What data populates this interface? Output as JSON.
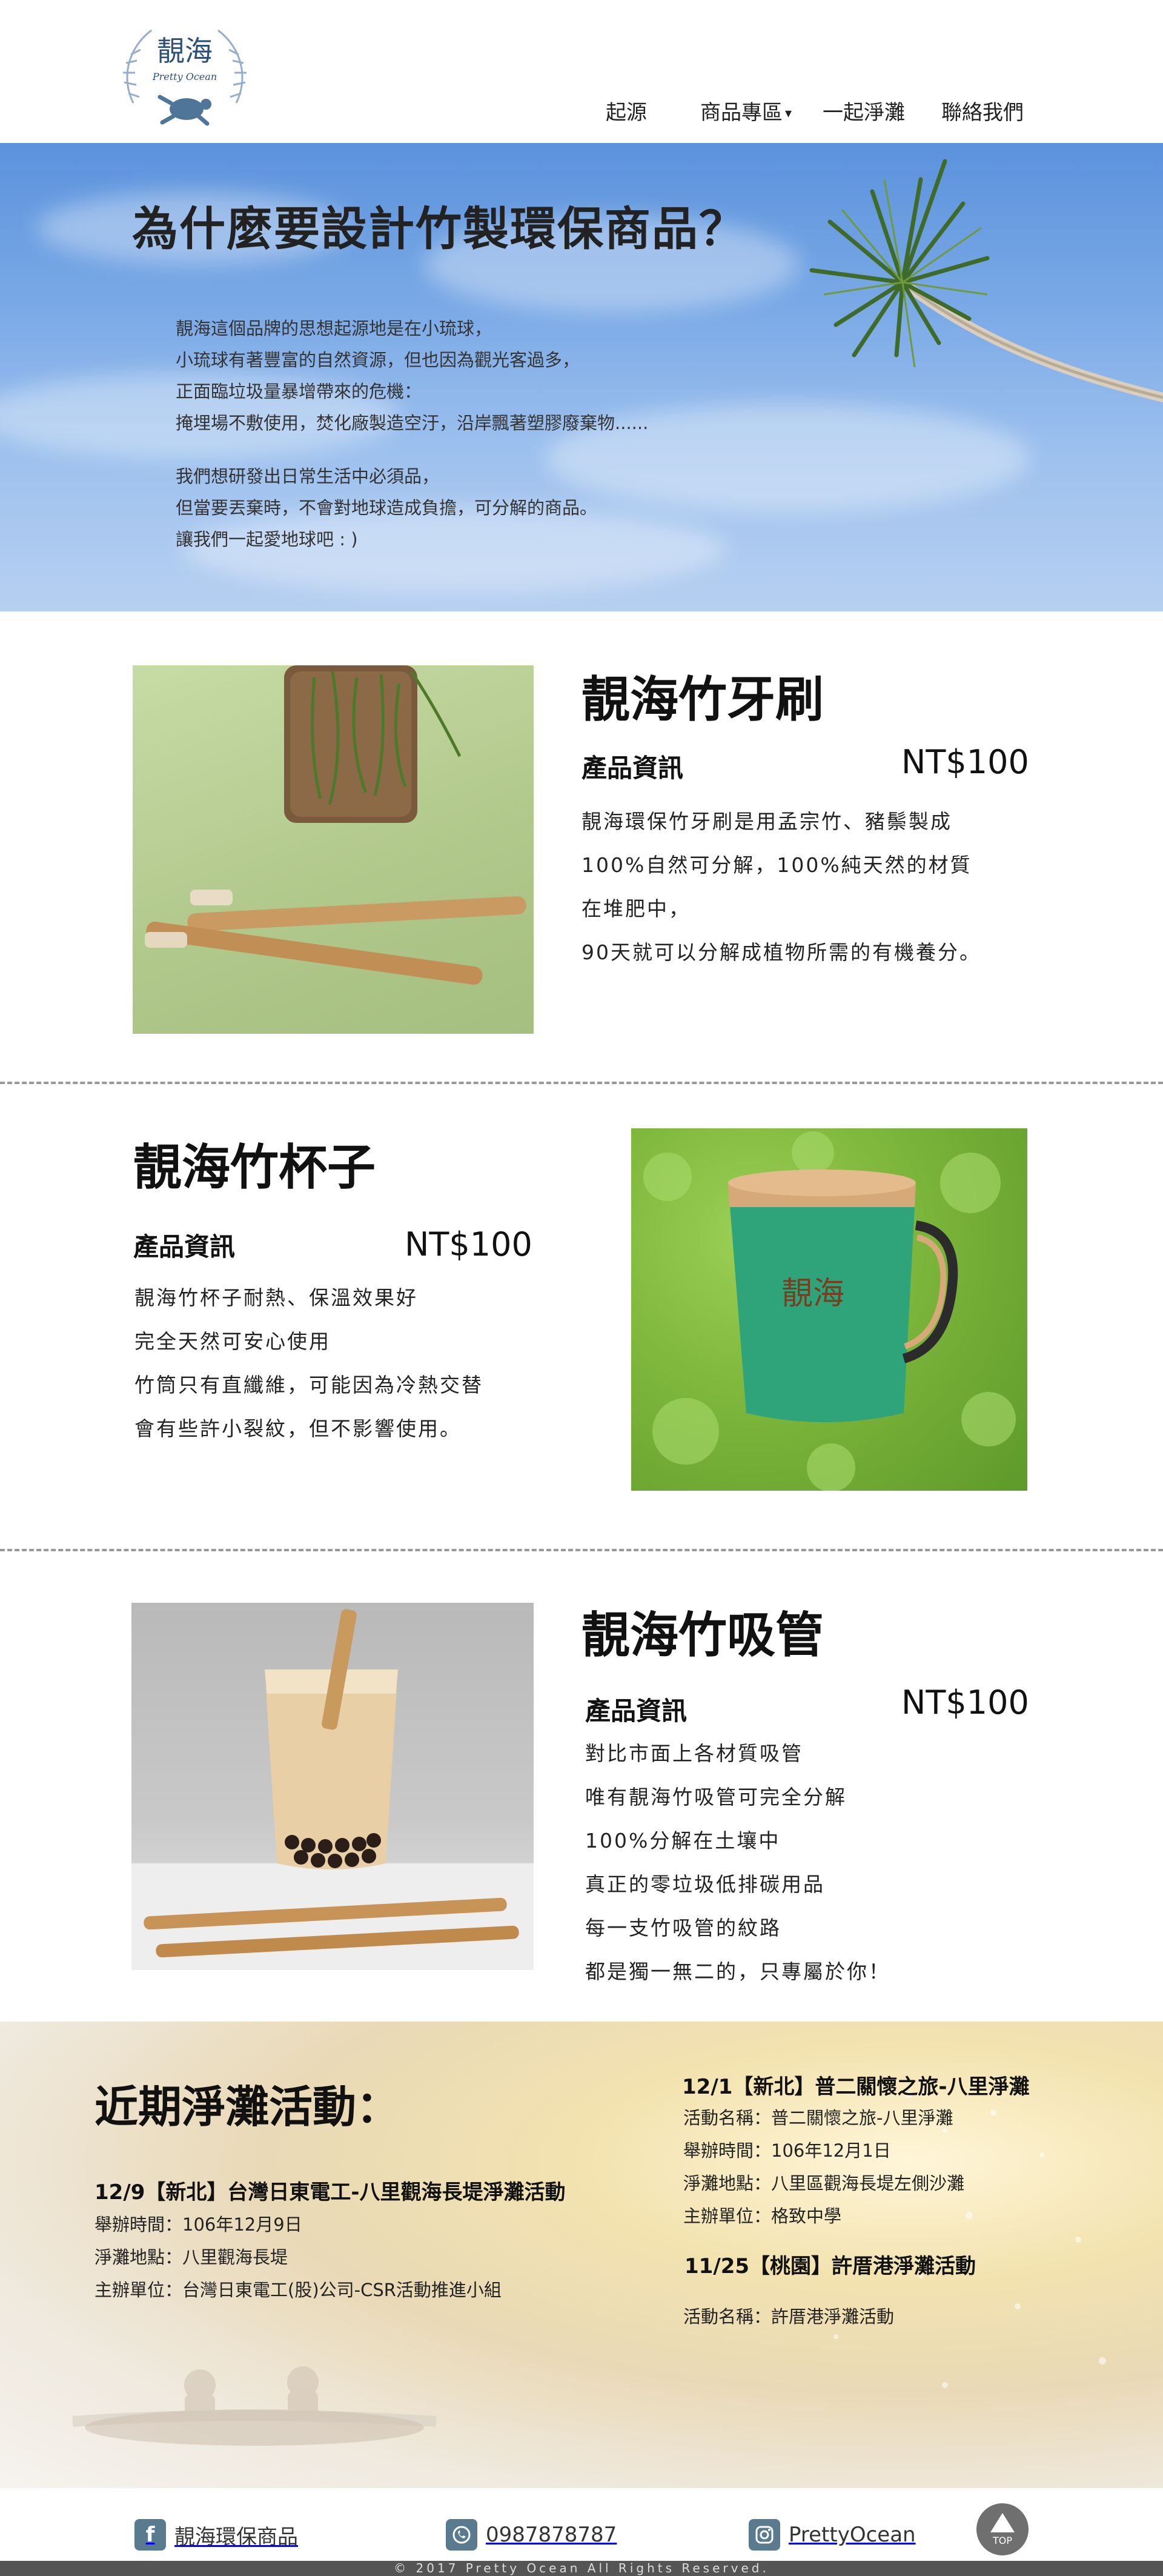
{
  "brand": {
    "logo_text": "靚海",
    "logo_subtext": "Pretty Ocean"
  },
  "nav": {
    "items": [
      {
        "label": "起源"
      },
      {
        "label": "商品專區"
      },
      {
        "label": "一起淨灘"
      },
      {
        "label": "聯絡我們"
      }
    ],
    "dropdown_caret": "▾"
  },
  "hero": {
    "title": "為什麼要設計竹製環保商品？",
    "paragraph1": [
      "靚海這個品牌的思想起源地是在小琉球，",
      "小琉球有著豐富的自然資源，但也因為觀光客過多，",
      "正面臨垃圾量暴增帶來的危機：",
      "掩埋場不敷使用，焚化廠製造空汙，沿岸飄著塑膠廢棄物......"
    ],
    "paragraph2": [
      "我們想研發出日常生活中必須品，",
      "但當要丟棄時，不會對地球造成負擔，可分解的商品。",
      "讓我們一起愛地球吧 : )"
    ]
  },
  "products": [
    {
      "name": "靚海竹牙刷",
      "info_label": "產品資訊",
      "price": "NT$100",
      "description": [
        "靚海環保竹牙刷是用孟宗竹、豬鬃製成",
        "100%自然可分解，100%純天然的材質",
        "在堆肥中，",
        "90天就可以分解成植物所需的有機養分。"
      ]
    },
    {
      "name": "靚海竹杯子",
      "info_label": "產品資訊",
      "price": "NT$100",
      "description": [
        "靚海竹杯子耐熱、保溫效果好",
        "完全天然可安心使用",
        "竹筒只有直纖維，可能因為冷熱交替",
        "會有些許小裂紋，但不影響使用。"
      ],
      "cup_print": "靚海"
    },
    {
      "name": "靚海竹吸管",
      "info_label": "產品資訊",
      "price": "NT$100",
      "description": [
        "對比市面上各材質吸管",
        "唯有靚海竹吸管可完全分解",
        "100%分解在土壤中",
        "真正的零垃圾低排碳用品",
        "每一支竹吸管的紋路",
        "都是獨一無二的，只專屬於你！"
      ]
    }
  ],
  "events": {
    "title": "近期淨灘活動：",
    "left": {
      "heading": "12/9【新北】台灣日東電工-八里觀海長堤淨灘活動",
      "lines": [
        "舉辦時間：106年12月9日",
        "淨灘地點：八里觀海長堤",
        "主辦單位：台灣日東電工(股)公司-CSR活動推進小組"
      ]
    },
    "right1": {
      "heading": "12/1【新北】普二關懷之旅-八里淨灘",
      "lines": [
        "活動名稱：普二關懷之旅-八里淨灘",
        "舉辦時間：106年12月1日",
        "淨灘地點：八里區觀海長堤左側沙灘",
        "主辦單位：格致中學"
      ]
    },
    "right2": {
      "heading": "11/25【桃園】許厝港淨灘活動",
      "lines": [
        "活動名稱：許厝港淨灘活動"
      ]
    }
  },
  "footer": {
    "facebook": {
      "icon": "facebook-icon",
      "label": "靚海環保商品"
    },
    "whatsapp": {
      "icon": "whatsapp-icon",
      "label": "0987878787"
    },
    "instagram": {
      "icon": "instagram-icon",
      "label": "PrettyOcean"
    },
    "top_label": "TOP",
    "copyright": "© 2017 Pretty Ocean  All Rights Reserved."
  }
}
